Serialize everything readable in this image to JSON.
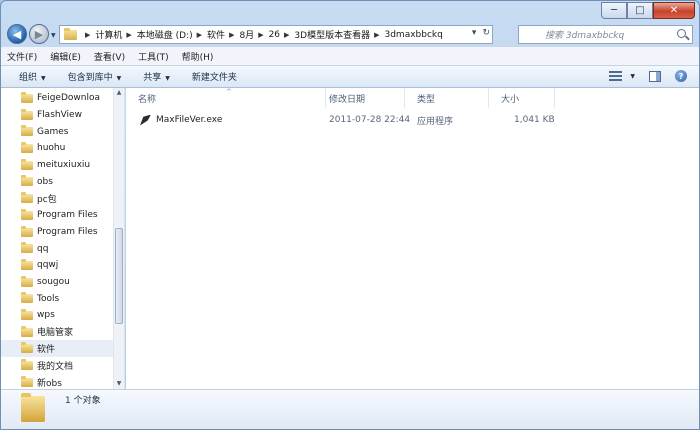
{
  "titlebar": {
    "caption_minimize": "─",
    "caption_maximize": "□",
    "caption_close": "✕"
  },
  "address": {
    "crumbs": [
      "计算机",
      "本地磁盘 (D:)",
      "软件",
      "8月",
      "26",
      "3D模型版本查看器",
      "3dmaxbbckq"
    ],
    "dropdown_glyph": "▾",
    "refresh_glyph": "↻"
  },
  "search": {
    "placeholder": "搜索 3dmaxbbckq"
  },
  "menu": [
    "文件(F)",
    "编辑(E)",
    "查看(V)",
    "工具(T)",
    "帮助(H)"
  ],
  "commands": {
    "organize": "组织",
    "include_in_library": "包含到库中",
    "share": "共享",
    "new_folder": "新建文件夹"
  },
  "tree": [
    {
      "label": "FeigeDownloa",
      "selected": false
    },
    {
      "label": "FlashView",
      "selected": false
    },
    {
      "label": "Games",
      "selected": false
    },
    {
      "label": "huohu",
      "selected": false
    },
    {
      "label": "meituxiuxiu",
      "selected": false
    },
    {
      "label": "obs",
      "selected": false
    },
    {
      "label": "pc包",
      "selected": false
    },
    {
      "label": "Program Files",
      "selected": false
    },
    {
      "label": "Program Files",
      "selected": false
    },
    {
      "label": "qq",
      "selected": false
    },
    {
      "label": "qqwj",
      "selected": false
    },
    {
      "label": "sougou",
      "selected": false
    },
    {
      "label": "Tools",
      "selected": false
    },
    {
      "label": "wps",
      "selected": false
    },
    {
      "label": "电脑管家",
      "selected": false
    },
    {
      "label": "软件",
      "selected": true
    },
    {
      "label": "我的文档",
      "selected": false
    },
    {
      "label": "新obs",
      "selected": false
    }
  ],
  "columns": {
    "name": "名称",
    "modified": "修改日期",
    "type": "类型",
    "size": "大小"
  },
  "files": [
    {
      "name": "MaxFileVer.exe",
      "modified": "2011-07-28 22:44",
      "type": "应用程序",
      "size": "1,041 KB"
    }
  ],
  "details": {
    "count": "1 个对象"
  }
}
